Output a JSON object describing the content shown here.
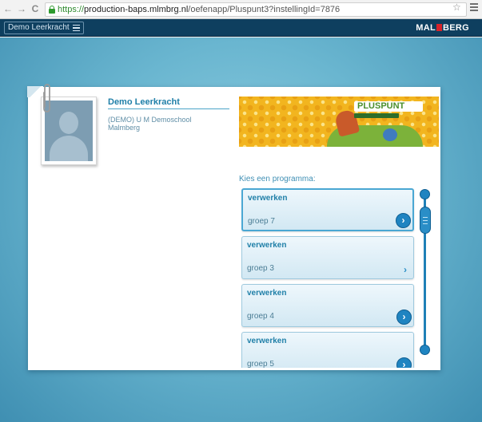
{
  "browser": {
    "url_scheme": "https://",
    "url_host": "production-baps.mlmbrg.nl",
    "url_path": "/oefenapp/Pluspunt3?instellingId=7876",
    "back_icon": "arrow-left-icon",
    "forward_icon": "arrow-right-icon",
    "reload_icon": "reload-icon",
    "bookmark_icon": "star-icon",
    "menu_icon": "hamburger-icon"
  },
  "header": {
    "user_label": "Demo Leerkracht",
    "brand_left": "MAL",
    "brand_right": "BERG",
    "background": "#0e3f5f"
  },
  "profile": {
    "name": "Demo Leerkracht",
    "school": "(DEMO) U M Demoschool",
    "subschool": "Malmberg"
  },
  "banner": {
    "logo_text": "PLUSPUNT"
  },
  "programs_label": "Kies een programma:",
  "programs": [
    {
      "title": "verwerken",
      "group": "groep 7",
      "selected": true
    },
    {
      "title": "verwerken",
      "group": "groep 3",
      "selected": false
    },
    {
      "title": "verwerken",
      "group": "groep 4",
      "selected": false
    },
    {
      "title": "verwerken",
      "group": "groep 5",
      "selected": false
    }
  ],
  "colors": {
    "accent": "#1f84c1",
    "title_blue": "#1f7fa8",
    "banner_yellow": "#f2b51f"
  }
}
